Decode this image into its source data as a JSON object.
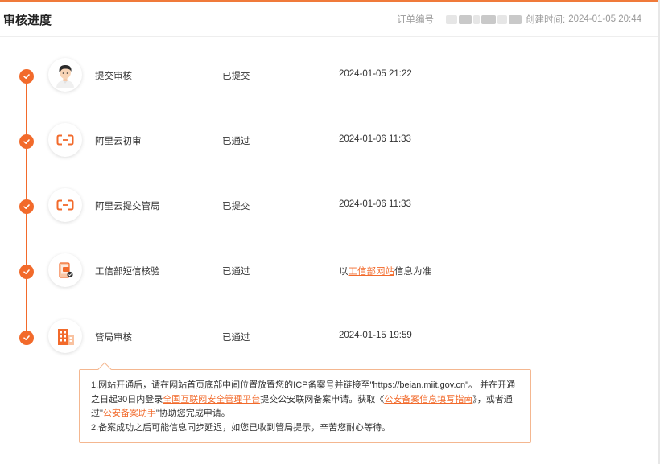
{
  "header": {
    "title": "审核进度",
    "order_label": "订单编号",
    "created_label": "创建时间:",
    "created_value": "2024-01-05 20:44"
  },
  "colors": {
    "accent": "#f26a2b",
    "border": "#f4b790"
  },
  "steps": [
    {
      "icon": "person-avatar-icon",
      "name": "提交审核",
      "status": "已提交",
      "time": "2024-01-05 21:22"
    },
    {
      "icon": "aliyun-logo-icon",
      "name": "阿里云初审",
      "status": "已通过",
      "time": "2024-01-06 11:33"
    },
    {
      "icon": "aliyun-logo-icon",
      "name": "阿里云提交管局",
      "status": "已提交",
      "time": "2024-01-06 11:33"
    },
    {
      "icon": "phone-sms-icon",
      "name": "工信部短信核验",
      "status": "已通过",
      "time_prefix": "以",
      "time_link": "工信部网站",
      "time_suffix": "信息为准"
    },
    {
      "icon": "building-icon",
      "name": "管局审核",
      "status": "已通过",
      "time": "2024-01-15 19:59"
    }
  ],
  "notice": {
    "p1_a": "1.网站开通后，请在网站首页底部中间位置放置您的ICP备案号并链接至\"https://beian.miit.gov.cn\"。 并在开通之日起30日内登录",
    "p1_link1": "全国互联网安全管理平台",
    "p1_b": "提交公安联网备案申请。获取《",
    "p1_link2": "公安备案信息填写指南",
    "p1_c": "》，或者通过\"",
    "p1_link3": "公安备案助手",
    "p1_d": "\"协助您完成申请。",
    "p2": "2.备案成功之后可能信息同步延迟，如您已收到管局提示，辛苦您耐心等待。"
  }
}
